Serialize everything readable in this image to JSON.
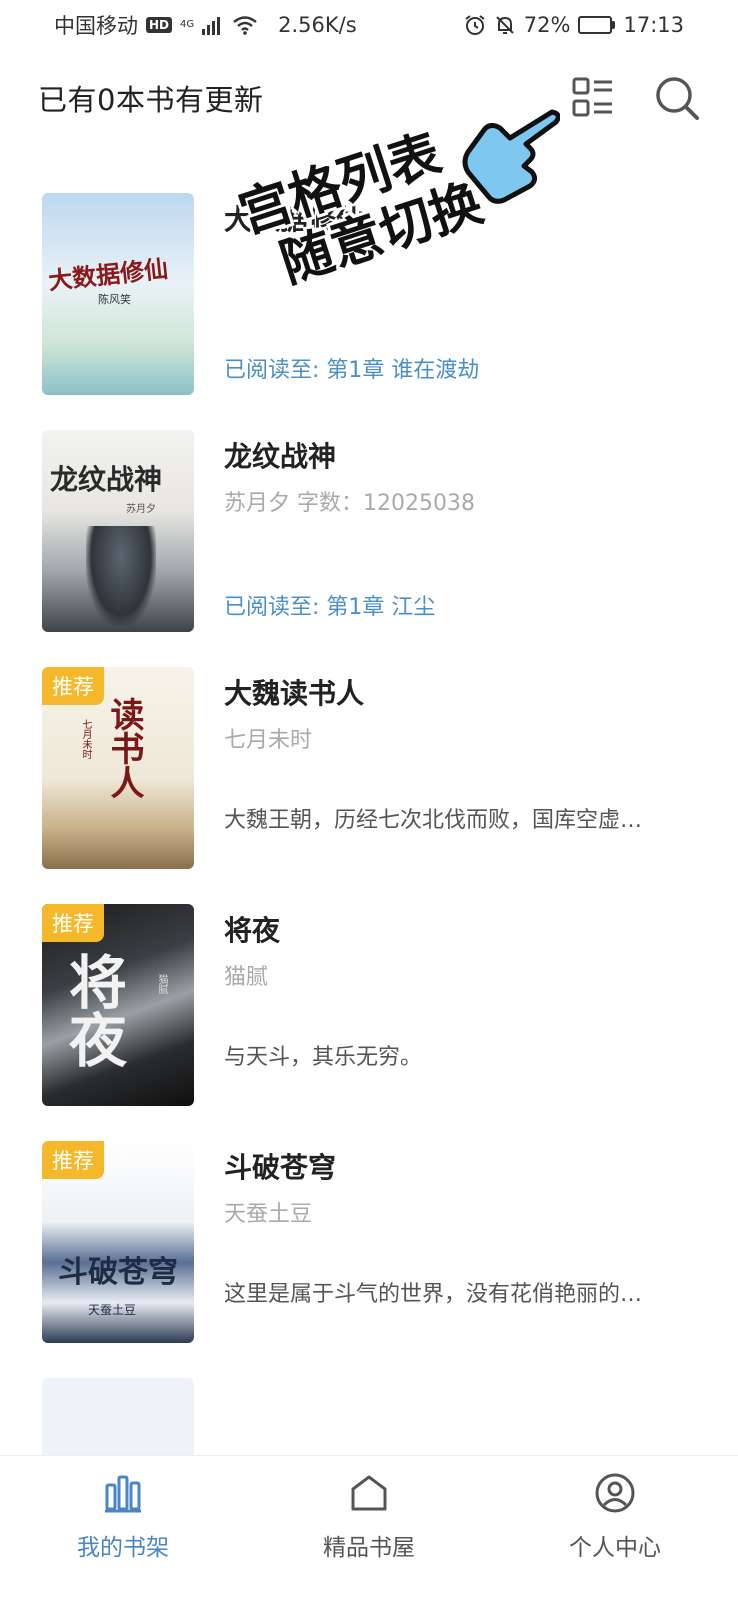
{
  "status_bar": {
    "carrier": "中国移动",
    "hd": "HD",
    "network": "4G",
    "speed": "2.56K/s",
    "battery": "72%",
    "battery_level": 0.72,
    "time": "17:13"
  },
  "header": {
    "title": "已有0本书有更新"
  },
  "promo": {
    "line1": "宫格列表",
    "line2": "随意切换"
  },
  "books": [
    {
      "title": "大数据修仙",
      "cover_text": "大数据修仙",
      "cover_author": "陈风笑",
      "meta": "",
      "progress": "已阅读至: 第1章 谁在渡劫",
      "desc": "",
      "badge": ""
    },
    {
      "title": "龙纹战神",
      "cover_text": "龙纹战神",
      "cover_author": "苏月夕",
      "meta": "苏月夕 字数：12025038",
      "progress": "已阅读至: 第1章 江尘",
      "desc": "",
      "badge": ""
    },
    {
      "title": "大魏读书人",
      "cover_text": "读书人",
      "cover_author": "七月未时",
      "meta": "七月未时",
      "progress": "",
      "desc": "大魏王朝，历经七次北伐而败，国库空虚…",
      "badge": "推荐"
    },
    {
      "title": "将夜",
      "cover_text": "将夜",
      "cover_author": "猫腻",
      "meta": "猫腻",
      "progress": "",
      "desc": "与天斗，其乐无穷。",
      "badge": "推荐"
    },
    {
      "title": "斗破苍穹",
      "cover_text": "斗破苍穹",
      "cover_author": "天蚕土豆",
      "meta": "天蚕土豆",
      "progress": "",
      "desc": "这里是属于斗气的世界，没有花俏艳丽的…",
      "badge": "推荐"
    }
  ],
  "bottom_nav": {
    "items": [
      {
        "label": "我的书架",
        "icon": "bookshelf-icon",
        "active": true
      },
      {
        "label": "精品书屋",
        "icon": "house-icon",
        "active": false
      },
      {
        "label": "个人中心",
        "icon": "user-circle-icon",
        "active": false
      }
    ]
  },
  "colors": {
    "accent": "#4a86c5",
    "progress": "#4a90c8",
    "badge": "#f5b82a",
    "pointer": "#7ec8f0"
  }
}
